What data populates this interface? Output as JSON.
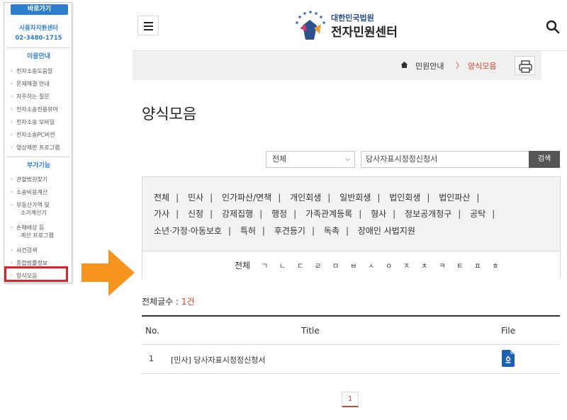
{
  "quick_nav": {
    "header": "바로가기",
    "center_name": "사용자지원센터",
    "center_phone": "02-3480-1715",
    "section1": "이용안내",
    "section1_items": [
      "전자소송도움말",
      "문제해결 안내",
      "자주하는 질문",
      "전자소송전용뷰어",
      "전자소송 모바일",
      "전자소송PC버전",
      "영상재판 프로그램"
    ],
    "section2": "부가기능",
    "section2_items": [
      "관할법원찾기",
      "소송비용계산",
      "부동산가액 및",
      "소가계산기",
      "손해배상 등",
      "계산 프로그램",
      "사건검색",
      "종합법률정보",
      "양식모음"
    ]
  },
  "header": {
    "logo_line1": "대한민국법원",
    "logo_line2": "전자민원센터"
  },
  "breadcrumb": {
    "home_icon": "home-icon",
    "item1": "민원안내",
    "separator": "〉",
    "item2": "양식모음"
  },
  "page": {
    "title": "양식모음"
  },
  "search": {
    "select_value": "전체",
    "input_value": "당사자표시정정신청서",
    "button_label": "검색"
  },
  "categories": {
    "line1": [
      "전체",
      "민사",
      "인가파산/면책",
      "개인회생",
      "일반회생",
      "법인회생",
      "법인파산"
    ],
    "line2": [
      "가사",
      "신청",
      "강제집행",
      "행정",
      "가족관계등록",
      "형사",
      "정보공개청구",
      "공탁"
    ],
    "line3": [
      "소년·가정·아동보호",
      "특허",
      "후견등기",
      "독촉",
      "장애인 사법지원"
    ]
  },
  "consonants": {
    "all": "전체",
    "items": [
      "ㄱ",
      "ㄴ",
      "ㄷ",
      "ㄹ",
      "ㅁ",
      "ㅂ",
      "ㅅ",
      "ㅇ",
      "ㅈ",
      "ㅊ",
      "ㅋ",
      "ㅌ",
      "ㅍ",
      "ㅎ"
    ]
  },
  "results": {
    "count_label": "전체글수 : ",
    "count_value": "1건"
  },
  "table": {
    "headers": {
      "no": "No.",
      "title": "Title",
      "file": "File"
    },
    "rows": [
      {
        "no": "1",
        "title": "[민사] 당사자표시정정신청서",
        "file_icon": "hwp-file-icon"
      }
    ]
  },
  "pagination": {
    "current": "1"
  },
  "colors": {
    "accent": "#d2482c",
    "brand_blue": "#2f7fd0",
    "highlight_red": "#e0202a",
    "arrow_orange": "#f7941d"
  }
}
